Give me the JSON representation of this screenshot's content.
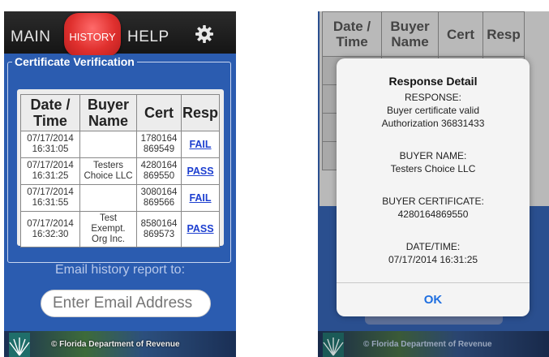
{
  "left": {
    "nav": {
      "main": "MAIN",
      "history": "HISTORY",
      "help": "HELP",
      "settings_icon": "gear-icon"
    },
    "section_title": "Certificate Verification",
    "table": {
      "headers": [
        "Date / Time",
        "Buyer Name",
        "Cert",
        "Resp"
      ],
      "rows": [
        {
          "date": "07/17/2014",
          "time": "16:31:05",
          "buyer": [
            "",
            "",
            ""
          ],
          "cert": [
            "1780164",
            "869549"
          ],
          "resp": "FAIL"
        },
        {
          "date": "07/17/2014",
          "time": "16:31:25",
          "buyer": [
            "Testers",
            "Choice LLC",
            ""
          ],
          "cert": [
            "4280164",
            "869550"
          ],
          "resp": "PASS"
        },
        {
          "date": "07/17/2014",
          "time": "16:31:55",
          "buyer": [
            "",
            "",
            ""
          ],
          "cert": [
            "3080164",
            "869566"
          ],
          "resp": "FAIL"
        },
        {
          "date": "07/17/2014",
          "time": "16:32:30",
          "buyer": [
            "Test",
            "Exempt.",
            "Org Inc."
          ],
          "cert": [
            "8580164",
            "869573"
          ],
          "resp": "PASS"
        }
      ]
    },
    "email_label": "Email history report to:",
    "email_placeholder": "Enter Email Address",
    "footer": "© Florida Department of Revenue",
    "colors": {
      "background": "#2b5cb0",
      "history_button": "#e0302e",
      "link": "#1d3fd0"
    }
  },
  "right": {
    "table_headers": [
      "Date / Time",
      "Buyer Name",
      "Cert",
      "Resp"
    ],
    "footer": "© Florida Department of Revenue",
    "dialog": {
      "title": "Response Detail",
      "response_label": "RESPONSE:",
      "response_line1": "Buyer certificate valid",
      "response_line2": "Authorization 36831433",
      "buyer_name_label": "BUYER NAME:",
      "buyer_name": "Testers Choice  LLC",
      "buyer_cert_label": "BUYER CERTIFICATE:",
      "buyer_cert": "4280164869550",
      "datetime_label": "DATE/TIME:",
      "datetime": "07/17/2014 16:31:25",
      "ok": "OK"
    },
    "colors": {
      "ok_button": "#1f6fe0"
    }
  }
}
